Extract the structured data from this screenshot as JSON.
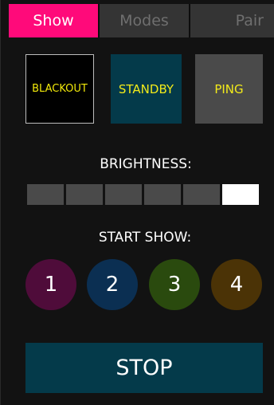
{
  "tabs": {
    "items": [
      {
        "label": "Show",
        "active": true
      },
      {
        "label": "Modes",
        "active": false
      },
      {
        "label": "Pair",
        "active": false
      }
    ]
  },
  "modes": {
    "blackout": {
      "label": "BLACKOUT"
    },
    "standby": {
      "label": "STANDBY"
    },
    "ping": {
      "label": "PING"
    }
  },
  "brightness": {
    "label": "BRIGHTNESS:",
    "segments": 6,
    "level": 6
  },
  "start_show": {
    "label": "START SHOW:",
    "buttons": [
      {
        "label": "1"
      },
      {
        "label": "2"
      },
      {
        "label": "3"
      },
      {
        "label": "4"
      }
    ]
  },
  "stop": {
    "label": "STOP"
  },
  "colors": {
    "tab_active_bg": "#ff0a7a",
    "tab_inactive_bg": "#343434",
    "blackout_text": "#f2e90a",
    "standby_bg": "#043a4a",
    "standby_text": "#f2ea1a",
    "ping_bg": "#4a4a4a",
    "ping_text": "#f2ea1a",
    "show_1": "#4f0c3a",
    "show_2": "#0b2f52",
    "show_3": "#2a4a0e",
    "show_4": "#4b3306",
    "stop_bg": "#043a4a"
  }
}
